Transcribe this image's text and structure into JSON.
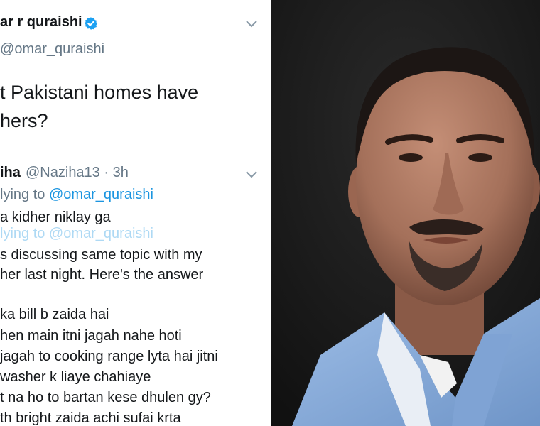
{
  "tweet": {
    "author_name": "ar r quraishi",
    "handle": "omar_quraishi",
    "question_lines": [
      "t Pakistani homes have",
      "hers?"
    ]
  },
  "reply": {
    "author_name": "iha",
    "meta": "@Naziha13 · 3h",
    "replying_prefix": "lying to ",
    "replying_mention": "@omar_quraishi",
    "ghost_text": "lying to @omar_quraishi",
    "lines": [
      "a kidher niklay ga",
      "s discussing same topic with my",
      "her last night. Here's the answer",
      "ka  bill b zaida hai",
      "hen main itni jagah nahe hoti",
      "jagah to cooking range lyta hai jitni",
      " washer k liaye chahiaye",
      "t na ho to bartan kese dhulen gy?",
      "th bright zaida achi sufai krta"
    ]
  },
  "icons": {
    "verified": "verified-badge-icon",
    "chevron": "chevron-down-icon"
  },
  "colors": {
    "twitter_blue": "#1b95e0",
    "muted_gray": "#657786",
    "text_dark": "#14171a",
    "photo_background": "#161616",
    "shirt_blue": "#8fb3df"
  }
}
